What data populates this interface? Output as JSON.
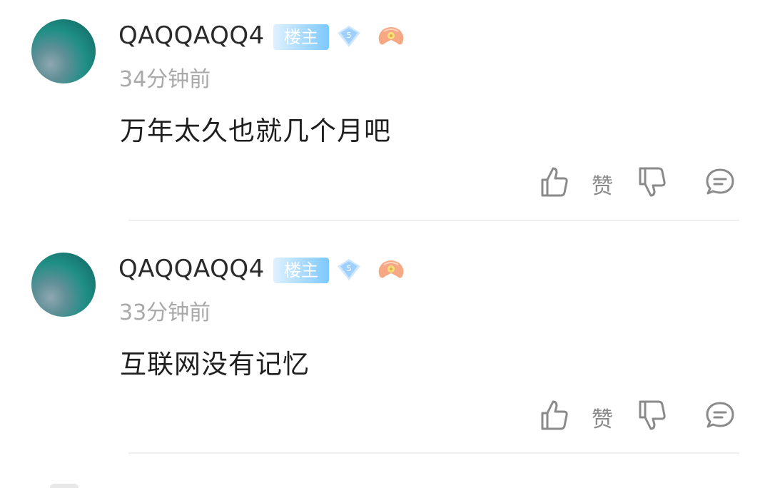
{
  "comments": [
    {
      "username": "QAQQAQQ4",
      "badge": "楼主",
      "level": "5",
      "time": "34分钟前",
      "content": "万年太久也就几个月吧",
      "like_label": "赞"
    },
    {
      "username": "QAQQAQQ4",
      "badge": "楼主",
      "level": "5",
      "time": "33分钟前",
      "content": "互联网没有记忆",
      "like_label": "赞"
    }
  ],
  "icons": {
    "like": "thumbs-up-icon",
    "dislike": "thumbs-down-icon",
    "reply": "comment-bubble-icon",
    "level": "level-diamond-icon",
    "game": "gamepad-icon"
  },
  "colors": {
    "badge_start": "#dff1ff",
    "badge_end": "#7cc8ff",
    "level_diamond": "#9fd0ff",
    "game_icon": "#f6a884"
  }
}
